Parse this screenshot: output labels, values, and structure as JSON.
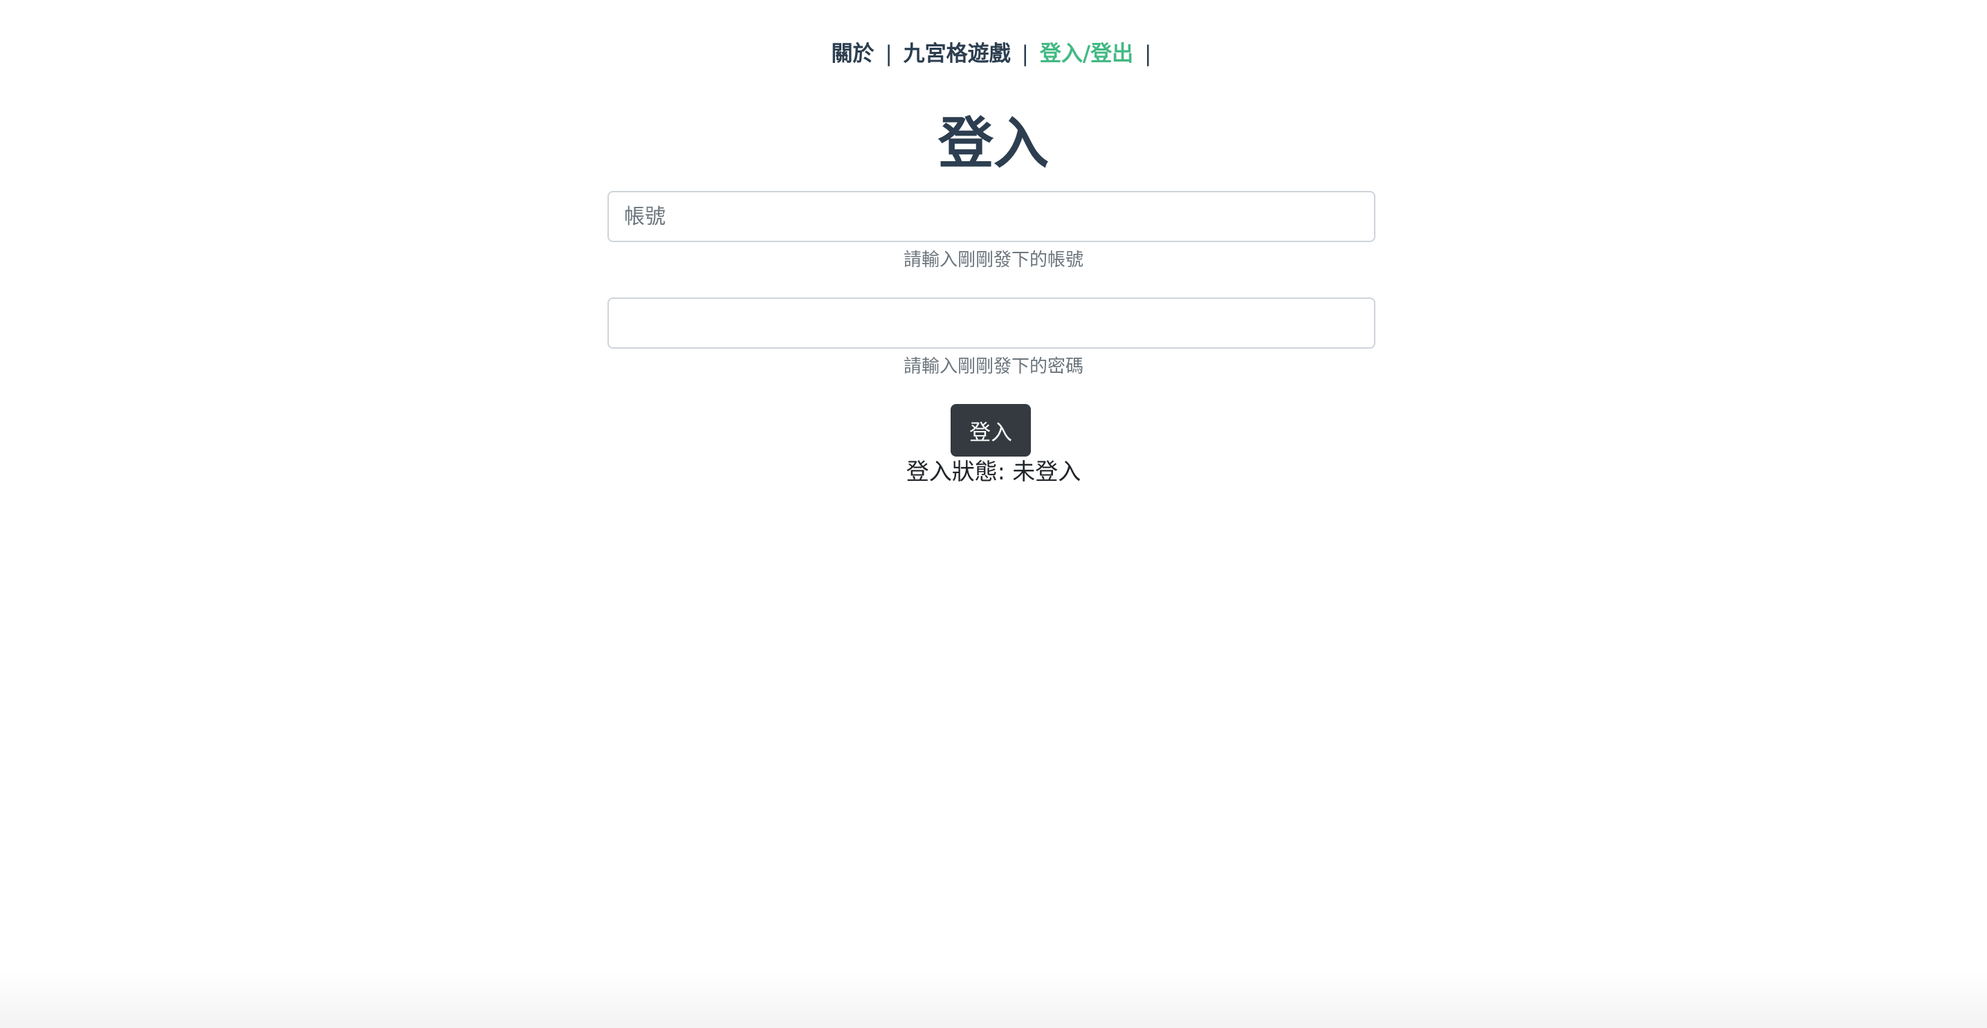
{
  "nav": {
    "items": [
      {
        "label": "關於",
        "active": false
      },
      {
        "label": "九宮格遊戲",
        "active": false
      },
      {
        "label": "登入/登出",
        "active": true
      }
    ],
    "separator": "|",
    "active_color": "#42b983",
    "text_color": "#2c3e50"
  },
  "login": {
    "title": "登入",
    "username": {
      "value": "",
      "placeholder": "帳號",
      "help": "請輸入剛剛發下的帳號"
    },
    "password": {
      "value": "",
      "placeholder": "",
      "help": "請輸入剛剛發下的密碼"
    },
    "submit_label": "登入",
    "status_label": "登入狀態: ",
    "status_value": "未登入",
    "button_color": "#343a40"
  }
}
